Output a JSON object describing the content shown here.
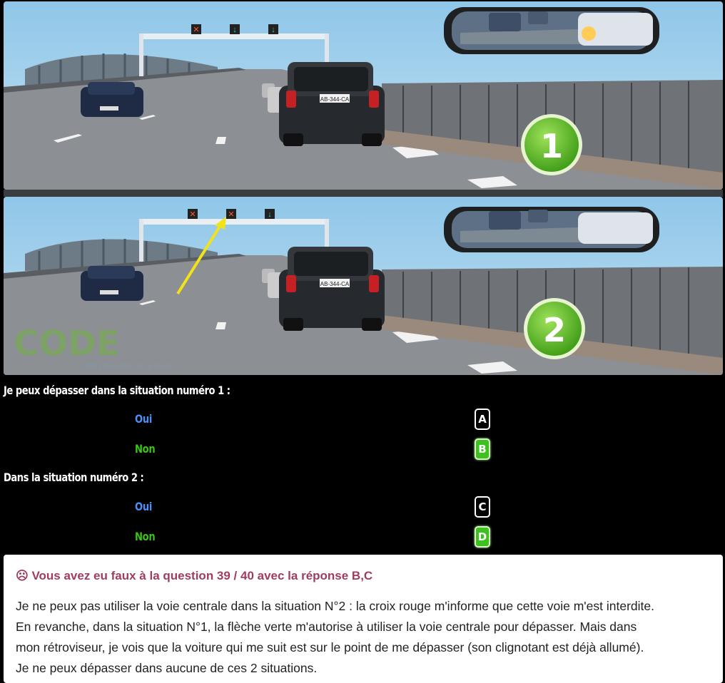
{
  "scenes": [
    {
      "badge": "1",
      "plate": "AB-344-CA"
    },
    {
      "badge": "2",
      "plate": "AB-344-CA",
      "watermark": "CODE",
      "watermark_small": "Tests du code de la route"
    }
  ],
  "questions": [
    {
      "text": "Je peux dépasser dans la situation numéro 1 :",
      "options": [
        {
          "label": "Oui",
          "key": "A",
          "selected": false
        },
        {
          "label": "Non",
          "key": "B",
          "selected": true
        }
      ]
    },
    {
      "text": "Dans la situation numéro 2 :",
      "options": [
        {
          "label": "Oui",
          "key": "C",
          "selected": false
        },
        {
          "label": "Non",
          "key": "D",
          "selected": true
        }
      ]
    }
  ],
  "feedback": {
    "icon": "sad-face-icon",
    "title": "☹ Vous avez eu faux à la question 39 / 40 avec la réponse B,C",
    "lines": [
      "Je ne peux pas utiliser la voie centrale dans la situation N°2 : la croix rouge m'informe que cette voie m'est interdite.",
      "En revanche, dans la situation N°1, la flèche verte m'autorise à utiliser la voie centrale pour dépasser. Mais dans",
      "mon rétroviseur, je vois que la voiture qui me suit est sur le point de me dépasser (son clignotant est déjà allumé).",
      "Je ne peux dépasser dans aucune de ces 2 situations."
    ]
  },
  "colors": {
    "title_red": "#a13d5c",
    "option_blue": "#4f8ef5",
    "option_green": "#3ac417",
    "selected_key": "#3cc11e"
  }
}
